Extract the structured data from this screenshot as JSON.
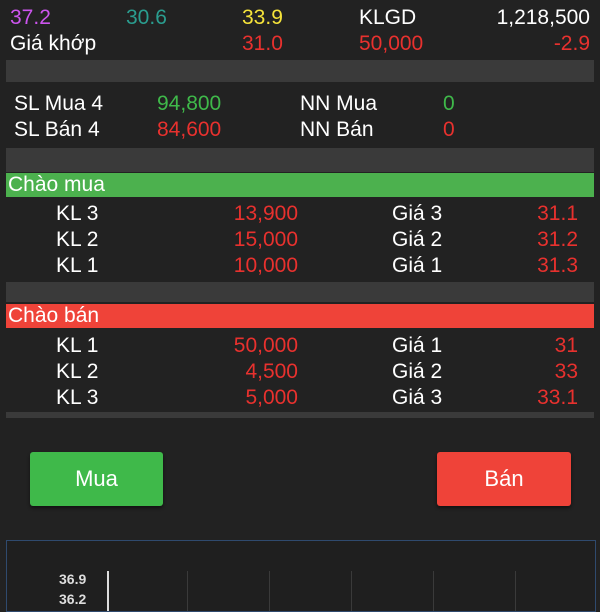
{
  "top": {
    "price_high": "37.2",
    "price_ref": "30.6",
    "price_ceiling": "33.9",
    "klgd_label": "KLGD",
    "klgd_value": "1,218,500",
    "match_label": "Giá khớp",
    "match_price": "31.0",
    "match_volume": "50,000",
    "match_change": "-2.9"
  },
  "stats": {
    "sl_mua_label": "SL Mua 4",
    "sl_mua_value": "94,800",
    "nn_mua_label": "NN Mua",
    "nn_mua_value": "0",
    "sl_ban_label": "SL Bán 4",
    "sl_ban_value": "84,600",
    "nn_ban_label": "NN Bán",
    "nn_ban_value": "0"
  },
  "bids": {
    "header": "Chào mua",
    "rows": [
      {
        "kl_label": "KL 3",
        "kl_value": "13,900",
        "gia_label": "Giá 3",
        "gia_value": "31.1"
      },
      {
        "kl_label": "KL 2",
        "kl_value": "15,000",
        "gia_label": "Giá 2",
        "gia_value": "31.2"
      },
      {
        "kl_label": "KL 1",
        "kl_value": "10,000",
        "gia_label": "Giá 1",
        "gia_value": "31.3"
      }
    ]
  },
  "asks": {
    "header": "Chào bán",
    "rows": [
      {
        "kl_label": "KL 1",
        "kl_value": "50,000",
        "gia_label": "Giá 1",
        "gia_value": "31"
      },
      {
        "kl_label": "KL 2",
        "kl_value": "4,500",
        "gia_label": "Giá 2",
        "gia_value": "33"
      },
      {
        "kl_label": "KL 3",
        "kl_value": "5,000",
        "gia_label": "Giá 3",
        "gia_value": "33.1"
      }
    ]
  },
  "buttons": {
    "buy": "Mua",
    "sell": "Bán"
  },
  "chart": {
    "y_tick_1": "36.9",
    "y_tick_2": "36.2"
  },
  "colors": {
    "purple": "#cc55ee",
    "teal": "#2a9d8f",
    "yellow": "#f5e33a",
    "red": "#e8312e",
    "green": "#3fb94a",
    "header_green": "#4cb14e",
    "header_red": "#ef4339"
  }
}
